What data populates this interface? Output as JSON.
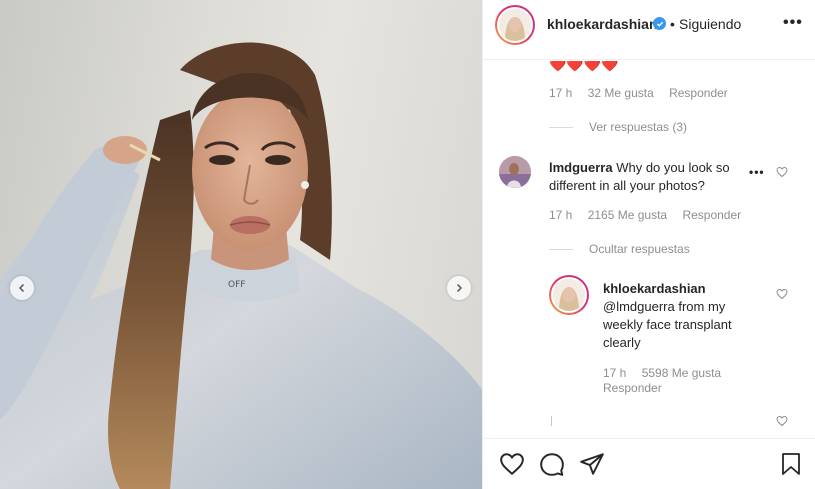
{
  "post": {
    "username": "khloekardashian",
    "separator": "•",
    "follow_status": "Siguiendo",
    "more_label": "•••"
  },
  "comments": {
    "prev_comment": {
      "emojis": "❤️❤️❤️❤️",
      "time": "17 h",
      "likes": "32 Me gusta",
      "reply": "Responder",
      "view_replies": "Ver respuestas (3)"
    },
    "main_comment": {
      "username": "lmdguerra",
      "text": "Why do you look so different in all your photos?",
      "time": "17 h",
      "likes": "2165 Me gusta",
      "reply": "Responder",
      "hide_replies": "Ocultar respuestas",
      "more_label": "•••"
    },
    "reply_comment": {
      "username": "khloekardashian",
      "mention": "@lmdguerra",
      "text": "from my weekly face transplant clearly",
      "time": "17 h",
      "likes": "5598 Me gusta",
      "reply": "Responder"
    }
  },
  "icons": {
    "like": "heart-icon",
    "comment": "comment-icon",
    "share": "paper-plane-icon",
    "save": "bookmark-icon",
    "verified": "verified-badge-icon",
    "prev": "chevron-left-icon",
    "next": "chevron-right-icon"
  },
  "colors": {
    "text": "#262626",
    "secondary": "#8e8e8e",
    "verified": "#3897f0",
    "heart": "#ed4956",
    "border": "#efefef"
  }
}
